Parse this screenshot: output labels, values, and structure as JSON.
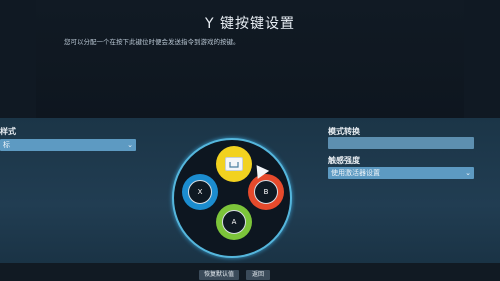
{
  "header": {
    "title": "Y 键按键设置",
    "subtitle": "您可以分配一个在按下此键位时便会发送指令到游戏的按键。"
  },
  "left_panel": {
    "label": "样式",
    "select_value": "标"
  },
  "right_panel": {
    "mode_label": "模式转换",
    "sensitivity_label": "触感强度",
    "sensitivity_value": "使用激活器设置"
  },
  "controller": {
    "buttons": [
      {
        "name": "Y",
        "glyph": "",
        "color": "#f2d21f"
      },
      {
        "name": "X",
        "glyph": "X",
        "color": "#1b8ccf"
      },
      {
        "name": "B",
        "glyph": "B",
        "color": "#e64a2c"
      },
      {
        "name": "A",
        "glyph": "A",
        "color": "#7cc43a"
      }
    ],
    "ring_color": "#55b6dc"
  },
  "footer": {
    "restore_default": "恢复默认值",
    "back": "返回"
  },
  "colors": {
    "background": "#101923",
    "band": "#213d52",
    "select": "#5d9ac2"
  }
}
